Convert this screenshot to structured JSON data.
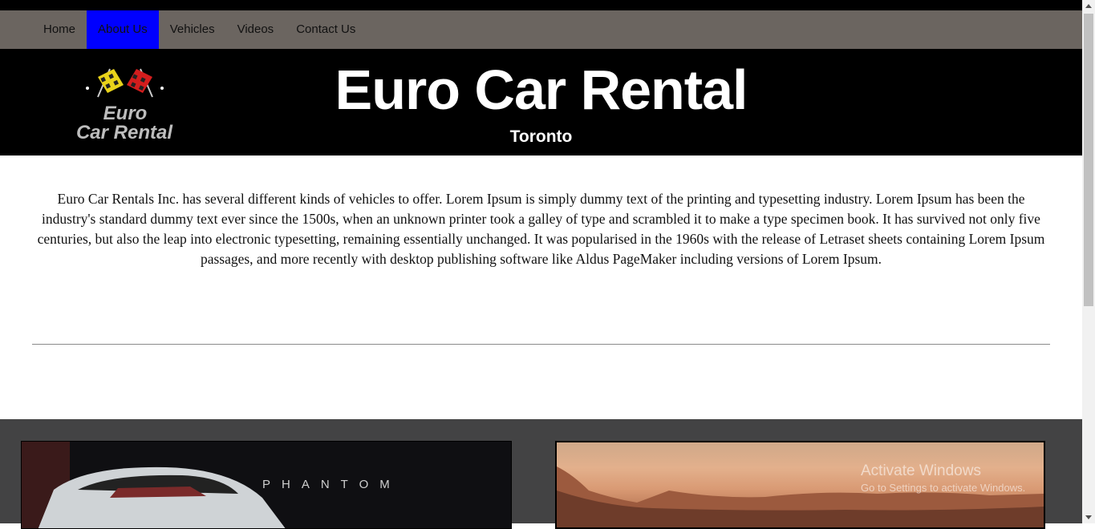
{
  "nav": {
    "items": [
      {
        "label": "Home"
      },
      {
        "label": "About Us",
        "active": true
      },
      {
        "label": "Vehicles"
      },
      {
        "label": "Videos"
      },
      {
        "label": "Contact Us"
      }
    ],
    "active_color": "#0000ff"
  },
  "header": {
    "logo_text": [
      "Euro",
      "Car Rental"
    ],
    "title": "Euro Car Rental",
    "subtitle": "Toronto"
  },
  "intro": {
    "text": "Euro Car Rentals Inc. has several different kinds of vehicles to offer. Lorem Ipsum is simply dummy text of the printing and typesetting industry. Lorem Ipsum has been the industry's standard dummy text ever since the 1500s, when an unknown printer took a galley of type and scrambled it to make a type specimen book. It has survived not only five centuries, but also the leap into electronic typesetting, remaining essentially unchanged. It was popularised in the 1960s with the release of Letraset sheets containing Lorem Ipsum passages, and more recently with desktop publishing software like Aldus PageMaker including versions of Lorem Ipsum."
  },
  "gallery": {
    "car_caption": "PHANTOM"
  },
  "watermark": {
    "title": "Activate Windows",
    "subtitle": "Go to Settings to activate Windows."
  }
}
